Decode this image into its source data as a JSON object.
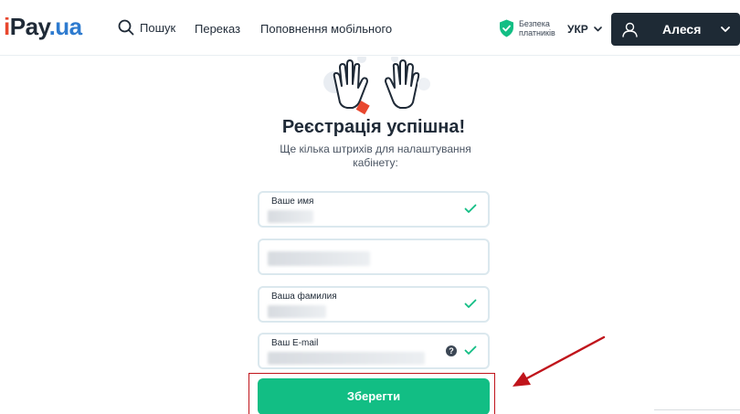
{
  "logo": {
    "part1": "i",
    "part2": "Pay",
    "part3": ".ua"
  },
  "nav": {
    "search": "Пошук",
    "transfer": "Переказ",
    "mobile": "Поповнення мобільного"
  },
  "security": {
    "line1": "Безпека",
    "line2": "платників"
  },
  "language": "УКР",
  "user": {
    "name": "Алеся"
  },
  "registration": {
    "title": "Реєстрація успішна!",
    "subtitle": "Ще кілька штрихів для налаштування кабінету:"
  },
  "form": {
    "fields": [
      {
        "label": "Ваше имя",
        "valid": true
      },
      {
        "label": "",
        "valid": false
      },
      {
        "label": "Ваша фамилия",
        "valid": true
      },
      {
        "label": "Ваш E-mail",
        "valid": true,
        "help": "?"
      }
    ],
    "save_label": "Зберегти"
  },
  "colors": {
    "accent_green": "#12be84",
    "header_dark": "#1e2a35",
    "highlight_red": "#c0141b",
    "logo_red": "#e8472e",
    "logo_blue": "#2e7bcf"
  }
}
